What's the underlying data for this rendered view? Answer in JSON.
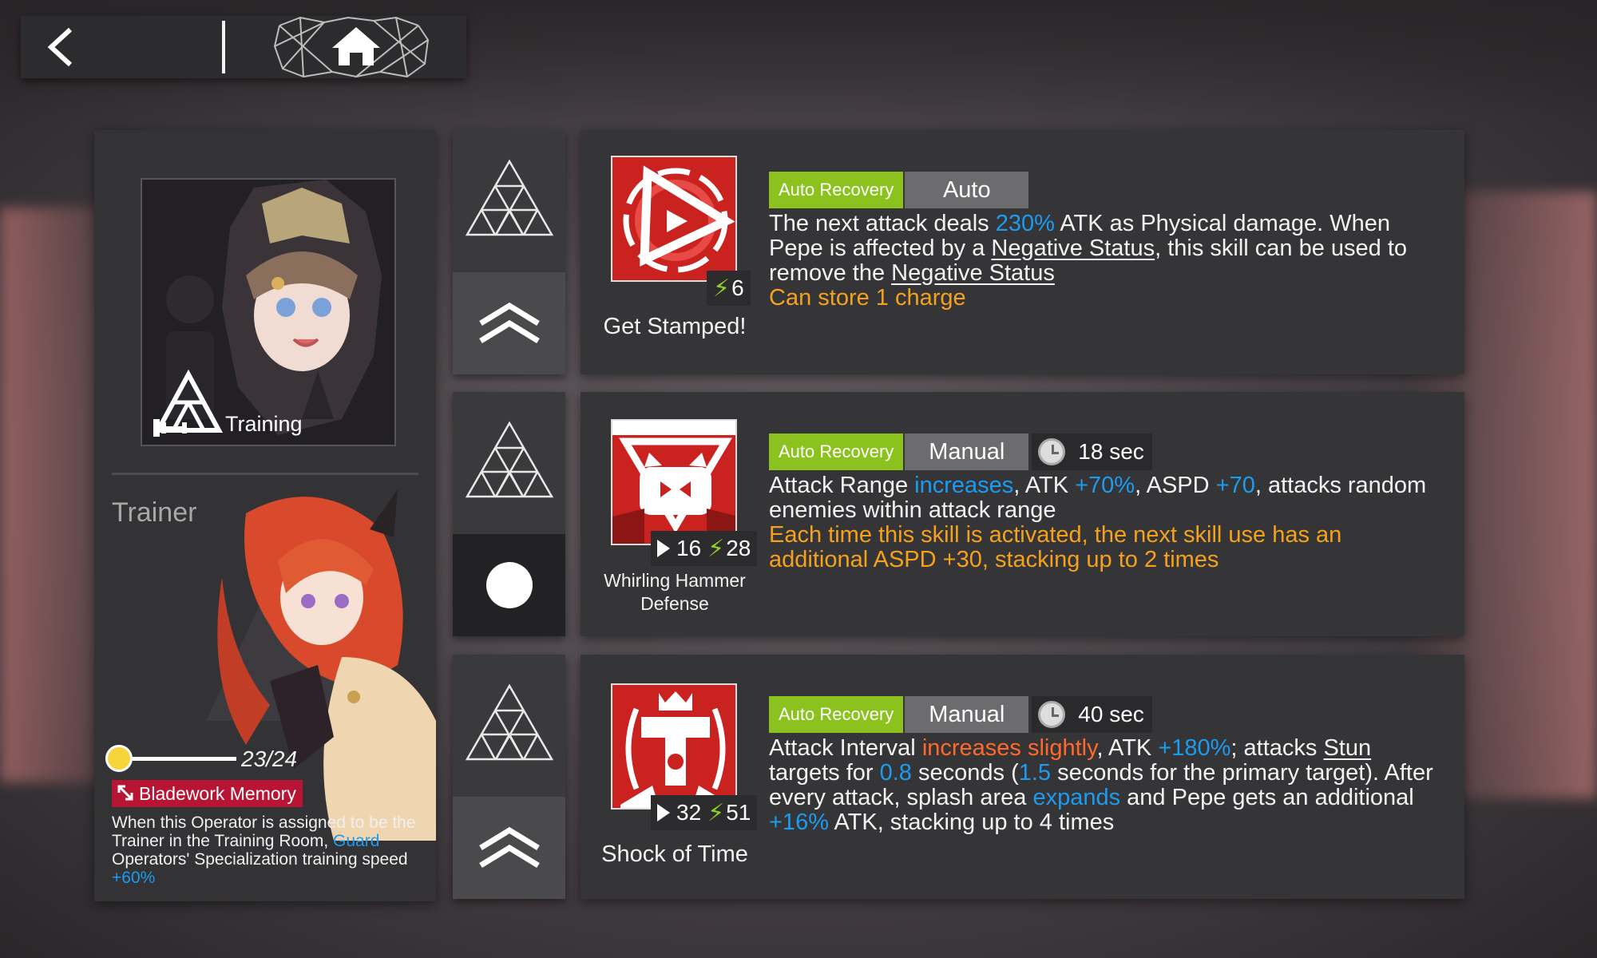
{
  "nav": {
    "back_icon": "chevron-left-icon",
    "home_icon": "home-icon"
  },
  "operator": {
    "portrait_label": "Training",
    "trainer_title": "Trainer",
    "progress_value": 23,
    "progress_max": 24,
    "progress_text": "23/24",
    "memory_name": "Bladework Memory",
    "trainer_desc_1": "When this Operator is assigned to be the Trainer in the Training Room, ",
    "trainer_desc_guard": "Guard",
    "trainer_desc_2": " Operators' Specialization training speed",
    "trainer_desc_bonus": "+60%"
  },
  "selectors": [
    {
      "name": "skill-1-mastery",
      "icon": "triangle-grid-icon"
    },
    {
      "name": "skill-1-upgrade",
      "icon": "double-chevron-up-icon"
    },
    {
      "name": "skill-2-mastery",
      "icon": "triangle-grid-icon"
    },
    {
      "name": "skill-2-selected",
      "icon": "circle-icon"
    },
    {
      "name": "skill-3-mastery",
      "icon": "triangle-grid-icon"
    },
    {
      "name": "skill-3-upgrade",
      "icon": "double-chevron-up-icon"
    }
  ],
  "skills": [
    {
      "name": "Get Stamped!",
      "sp_cost": "6",
      "recovery": "Auto Recovery",
      "activation": "Auto",
      "desc_a": "The next attack deals ",
      "desc_b": "230%",
      "desc_c": " ATK as Physical damage. When Pepe is affected by a ",
      "desc_d": "Negative Status",
      "desc_e": ", this skill can be used to remove the ",
      "desc_f": "Negative Status",
      "note": "Can store 1 charge"
    },
    {
      "name": "Whirling Hammer Defense",
      "initial_sp": "16",
      "sp_cost": "28",
      "recovery": "Auto Recovery",
      "activation": "Manual",
      "duration": "18 sec",
      "d1": "Attack Range ",
      "d2": "increases",
      "d3": ", ATK ",
      "d4": "+70%",
      "d5": ", ASPD ",
      "d6": "+70",
      "d7": ", attacks random enemies within attack range",
      "note": "Each time this skill is activated, the next skill use has an additional ASPD +30, stacking up to 2 times"
    },
    {
      "name": "Shock of Time",
      "initial_sp": "32",
      "sp_cost": "51",
      "recovery": "Auto Recovery",
      "activation": "Manual",
      "duration": "40 sec",
      "d1": "Attack Interval ",
      "d2": "increases slightly",
      "d3": ", ATK ",
      "d4": "+180%",
      "d5": "; attacks ",
      "d6": "Stun",
      "d7": " targets for ",
      "d8": "0.8",
      "d9": " seconds (",
      "d10": "1.5",
      "d11": " seconds for the primary target). After every attack, splash area ",
      "d12": "expands",
      "d13": " and Pepe gets an additional ",
      "d14": "+16%",
      "d15": " ATK, stacking up to 4 times"
    }
  ],
  "colors": {
    "accent_green": "#8bc21e",
    "highlight_blue": "#1b9cf0",
    "note_orange": "#f4a21e",
    "debuff_orange": "#ff6a2a",
    "memory_red": "#b81434"
  }
}
